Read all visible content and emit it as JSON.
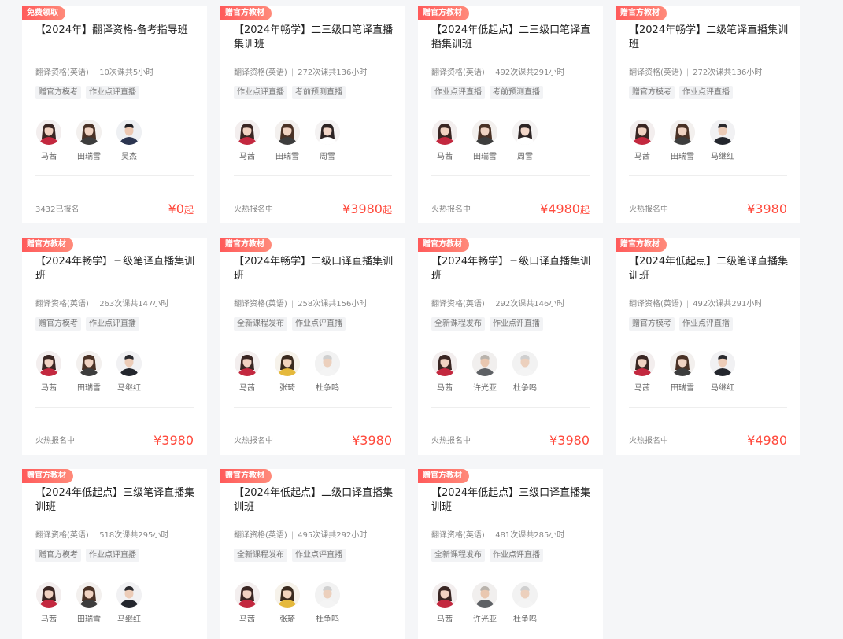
{
  "courses": [
    {
      "badge": "免费领取",
      "title": "【2024年】翻译资格-备考指导班",
      "category": "翻译资格(英语)",
      "lessons": "10次课共5小时",
      "tags": [
        "赠官方模考",
        "作业点评直播"
      ],
      "teachers": [
        {
          "name": "马茜",
          "style": "f1"
        },
        {
          "name": "田瑞雪",
          "style": "f2"
        },
        {
          "name": "吴杰",
          "style": "m1"
        }
      ],
      "enroll": "3432已报名",
      "price": "¥0",
      "price_suffix": "起"
    },
    {
      "badge": "赠官方教材",
      "title": "【2024年畅学】二三级口笔译直播集训班",
      "category": "翻译资格(英语)",
      "lessons": "272次课共136小时",
      "tags": [
        "作业点评直播",
        "考前预测直播"
      ],
      "teachers": [
        {
          "name": "马茜",
          "style": "f1"
        },
        {
          "name": "田瑞雪",
          "style": "f2"
        },
        {
          "name": "周雪",
          "style": "f3"
        }
      ],
      "enroll": "火热报名中",
      "price": "¥3980",
      "price_suffix": "起"
    },
    {
      "badge": "赠官方教材",
      "title": "【2024年低起点】二三级口笔译直播集训班",
      "category": "翻译资格(英语)",
      "lessons": "492次课共291小时",
      "tags": [
        "作业点评直播",
        "考前预测直播"
      ],
      "teachers": [
        {
          "name": "马茜",
          "style": "f1"
        },
        {
          "name": "田瑞雪",
          "style": "f2"
        },
        {
          "name": "周雪",
          "style": "f3"
        }
      ],
      "enroll": "火热报名中",
      "price": "¥4980",
      "price_suffix": "起"
    },
    {
      "badge": "赠官方教材",
      "title": "【2024年畅学】二级笔译直播集训班",
      "category": "翻译资格(英语)",
      "lessons": "272次课共136小时",
      "tags": [
        "赠官方模考",
        "作业点评直播"
      ],
      "teachers": [
        {
          "name": "马茜",
          "style": "f1"
        },
        {
          "name": "田瑞雪",
          "style": "f2"
        },
        {
          "name": "马继红",
          "style": "m2"
        }
      ],
      "enroll": "火热报名中",
      "price": "¥3980",
      "price_suffix": ""
    },
    {
      "badge": "赠官方教材",
      "title": "【2024年畅学】三级笔译直播集训班",
      "category": "翻译资格(英语)",
      "lessons": "263次课共147小时",
      "tags": [
        "赠官方模考",
        "作业点评直播"
      ],
      "teachers": [
        {
          "name": "马茜",
          "style": "f1"
        },
        {
          "name": "田瑞雪",
          "style": "f2"
        },
        {
          "name": "马继红",
          "style": "m2"
        }
      ],
      "enroll": "火热报名中",
      "price": "¥3980",
      "price_suffix": ""
    },
    {
      "badge": "赠官方教材",
      "title": "【2024年畅学】二级口译直播集训班",
      "category": "翻译资格(英语)",
      "lessons": "258次课共156小时",
      "tags": [
        "全新课程发布",
        "作业点评直播"
      ],
      "teachers": [
        {
          "name": "马茜",
          "style": "f1"
        },
        {
          "name": "张琦",
          "style": "f4"
        },
        {
          "name": "杜争鸣",
          "style": "m3"
        }
      ],
      "enroll": "火热报名中",
      "price": "¥3980",
      "price_suffix": ""
    },
    {
      "badge": "赠官方教材",
      "title": "【2024年畅学】三级口译直播集训班",
      "category": "翻译资格(英语)",
      "lessons": "292次课共146小时",
      "tags": [
        "全新课程发布",
        "作业点评直播"
      ],
      "teachers": [
        {
          "name": "马茜",
          "style": "f1"
        },
        {
          "name": "许光亚",
          "style": "m4"
        },
        {
          "name": "杜争鸣",
          "style": "m3"
        }
      ],
      "enroll": "火热报名中",
      "price": "¥3980",
      "price_suffix": ""
    },
    {
      "badge": "赠官方教材",
      "title": "【2024年低起点】二级笔译直播集训班",
      "category": "翻译资格(英语)",
      "lessons": "492次课共291小时",
      "tags": [
        "赠官方模考",
        "作业点评直播"
      ],
      "teachers": [
        {
          "name": "马茜",
          "style": "f1"
        },
        {
          "name": "田瑞雪",
          "style": "f2"
        },
        {
          "name": "马继红",
          "style": "m2"
        }
      ],
      "enroll": "火热报名中",
      "price": "¥4980",
      "price_suffix": ""
    },
    {
      "badge": "赠官方教材",
      "title": "【2024年低起点】三级笔译直播集训班",
      "category": "翻译资格(英语)",
      "lessons": "518次课共295小时",
      "tags": [
        "赠官方模考",
        "作业点评直播"
      ],
      "teachers": [
        {
          "name": "马茜",
          "style": "f1"
        },
        {
          "name": "田瑞雪",
          "style": "f2"
        },
        {
          "name": "马继红",
          "style": "m2"
        }
      ]
    },
    {
      "badge": "赠官方教材",
      "title": "【2024年低起点】二级口译直播集训班",
      "category": "翻译资格(英语)",
      "lessons": "495次课共292小时",
      "tags": [
        "全新课程发布",
        "作业点评直播"
      ],
      "teachers": [
        {
          "name": "马茜",
          "style": "f1"
        },
        {
          "name": "张琦",
          "style": "f4"
        },
        {
          "name": "杜争鸣",
          "style": "m3"
        }
      ]
    },
    {
      "badge": "赠官方教材",
      "title": "【2024年低起点】三级口译直播集训班",
      "category": "翻译资格(英语)",
      "lessons": "481次课共285小时",
      "tags": [
        "全新课程发布",
        "作业点评直播"
      ],
      "teachers": [
        {
          "name": "马茜",
          "style": "f1"
        },
        {
          "name": "许光亚",
          "style": "m4"
        },
        {
          "name": "杜争鸣",
          "style": "m3"
        }
      ]
    }
  ],
  "colors": {
    "accent": "#ff4a3d",
    "badge": "#ff5a5a",
    "background": "#f5f6f8"
  }
}
